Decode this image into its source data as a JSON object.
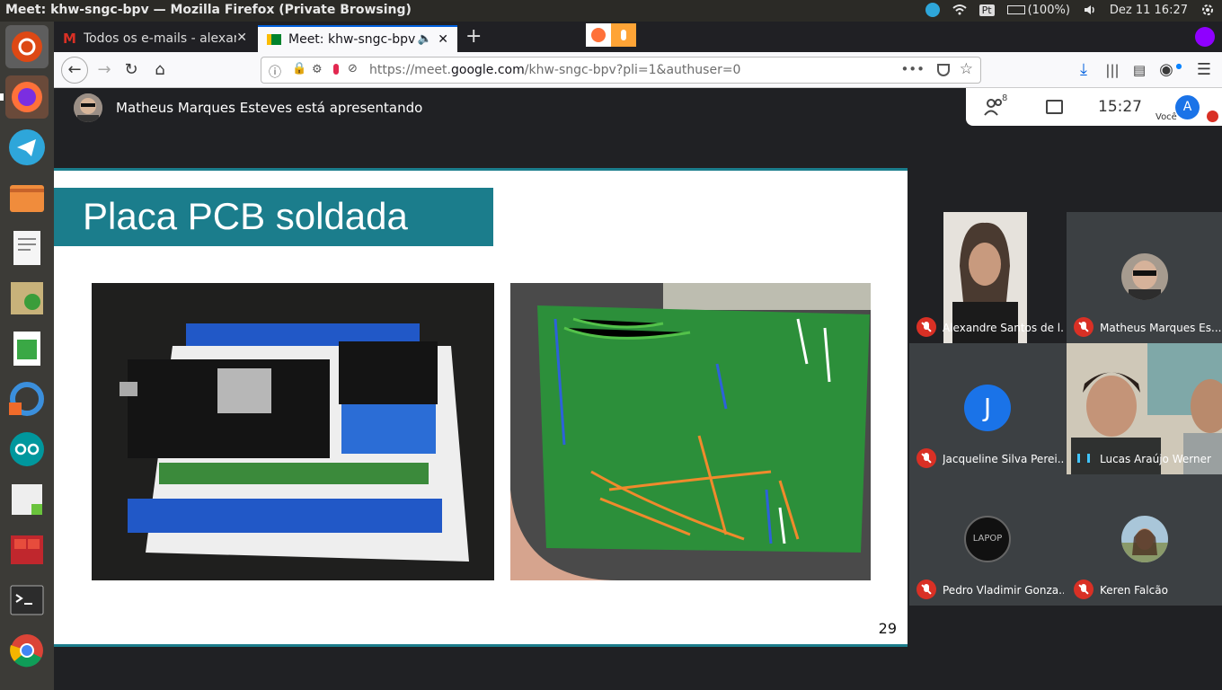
{
  "system": {
    "window_title": "Meet: khw-sngc-bpv — Mozilla Firefox (Private Browsing)",
    "keyboard": "Pt",
    "battery": "(100%)",
    "clock": "Dez 11  16:27"
  },
  "browser": {
    "tabs": [
      {
        "label": "Todos os e-mails - alexan"
      },
      {
        "label": "Meet: khw-sngc-bpv"
      }
    ],
    "url_prefix": "https://meet.",
    "url_domain": "google.com",
    "url_path": "/khw-sngc-bpv?pli=1&authuser=0",
    "new_tab": "+",
    "page_actions": "•••"
  },
  "meet": {
    "presenter_text": "Matheus Marques Esteves está apresentando",
    "participants_count": "8",
    "meeting_time": "15:27",
    "self_avatar": "A",
    "self_label": "Você"
  },
  "slide": {
    "title": "Placa PCB soldada",
    "page_number": "29"
  },
  "participants": [
    {
      "name": "Alexandre Santos de l...",
      "muted": true,
      "tile": "video"
    },
    {
      "name": "Matheus Marques Es...",
      "muted": true,
      "tile": "photo"
    },
    {
      "name": "Jacqueline Silva Perei...",
      "muted": true,
      "tile": "letter",
      "letter": "J",
      "color": "#1a73e8"
    },
    {
      "name": "Lucas Araújo Werner",
      "muted": false,
      "tile": "video"
    },
    {
      "name": "Pedro Vladimir Gonza...",
      "muted": true,
      "tile": "logo",
      "logo_text": "LAPOP"
    },
    {
      "name": "Keren Falcão",
      "muted": true,
      "tile": "photo"
    }
  ],
  "colors": {
    "slide_accent": "#1b7d8c",
    "mic_muted": "#d93025",
    "meet_bg": "#202124"
  }
}
